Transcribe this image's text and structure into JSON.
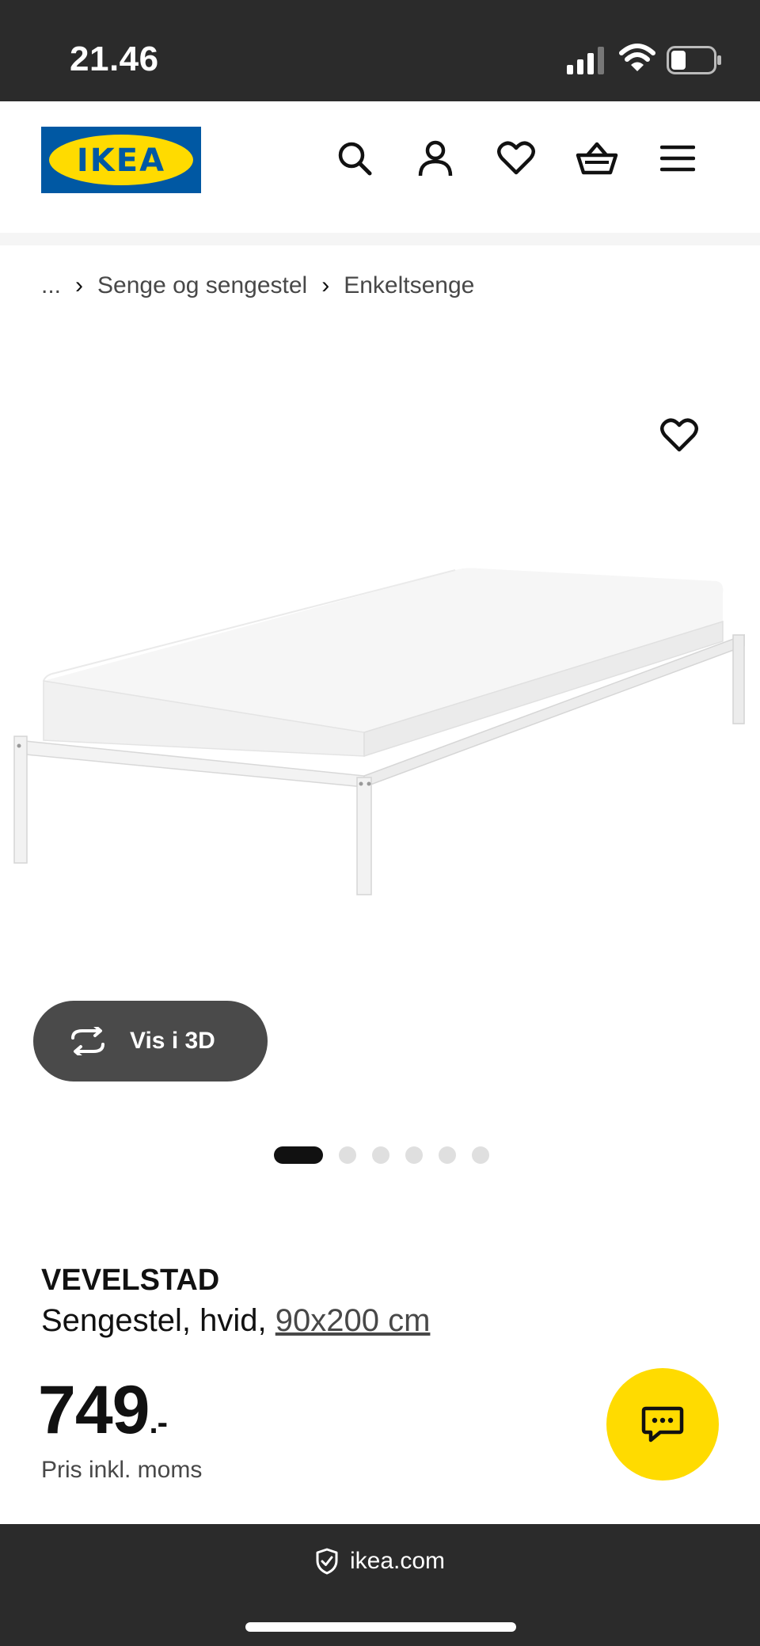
{
  "status": {
    "time": "21.46",
    "battery_level": 0.3
  },
  "brand": {
    "logo_text": "IKEA",
    "blue": "#0058a3",
    "yellow": "#ffdb00"
  },
  "header_icons": [
    "search-icon",
    "account-icon",
    "heart-icon",
    "basket-icon",
    "menu-icon"
  ],
  "breadcrumb": {
    "items": [
      "...",
      "Senge og sengestel",
      "Enkeltsenge"
    ]
  },
  "gallery": {
    "view3d_label": "Vis i 3D",
    "image_count": 6,
    "active_index": 0
  },
  "product": {
    "name": "VEVELSTAD",
    "description_prefix": "Sengestel, hvid, ",
    "size_link": "90x200 cm",
    "price": "749",
    "price_suffix": ".-",
    "price_note": "Pris inkl. moms"
  },
  "browser": {
    "url": "ikea.com"
  }
}
